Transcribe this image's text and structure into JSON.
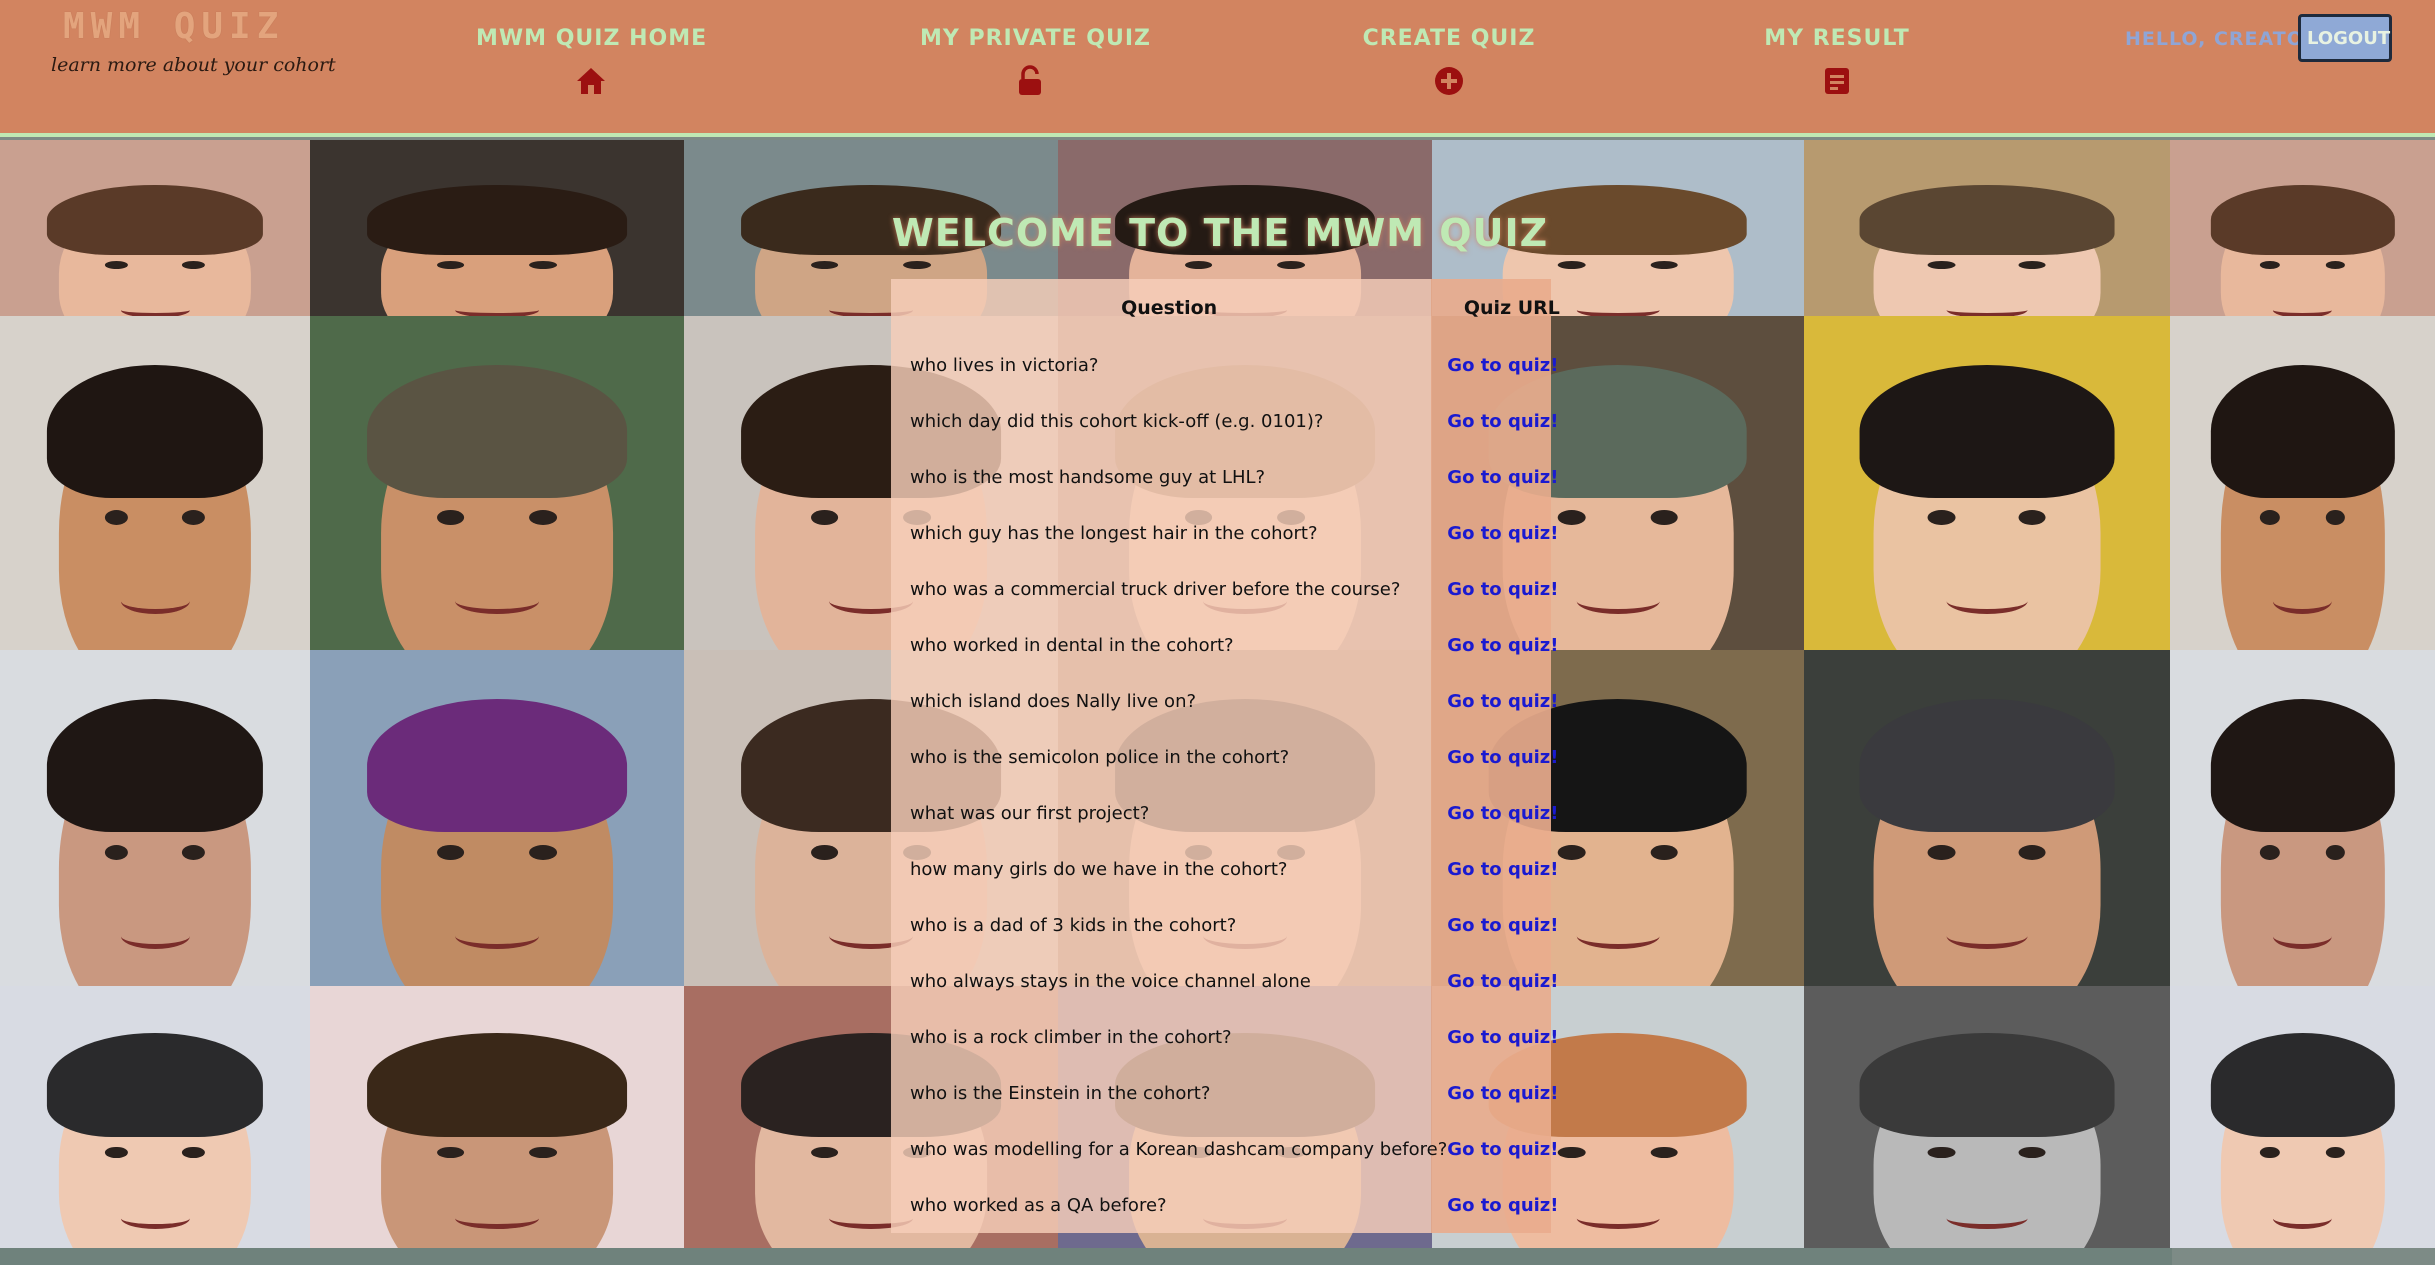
{
  "header": {
    "logo_title": "MWM QUIZ",
    "logo_tagline": "learn more about your cohort",
    "nav": [
      {
        "label": "MWM QUIZ HOME",
        "icon": "home-icon"
      },
      {
        "label": "MY PRIVATE QUIZ",
        "icon": "unlock-icon"
      },
      {
        "label": "CREATE QUIZ",
        "icon": "plus-circle-icon"
      },
      {
        "label": "MY RESULT",
        "icon": "document-icon"
      }
    ],
    "greeting": "HELLO, CREATOR!",
    "logout_label": "LOGOUT"
  },
  "colors": {
    "header_bg": "#d28460",
    "accent_green": "#bfe9b4",
    "icon_red": "#9c1010",
    "link_blue": "#1a1ad0",
    "logout_bg": "#8fa9d6"
  },
  "main": {
    "title": "WELCOME TO THE MWM QUIZ",
    "table": {
      "headers": [
        "Question",
        "Quiz URL"
      ],
      "rows": [
        {
          "question": "who lives in victoria?",
          "link": "Go to quiz!"
        },
        {
          "question": "which day did this cohort kick-off (e.g. 0101)?",
          "link": "Go to quiz!"
        },
        {
          "question": "who is the most handsome guy at LHL?",
          "link": "Go to quiz!"
        },
        {
          "question": "which guy has the longest hair in the cohort?",
          "link": "Go to quiz!"
        },
        {
          "question": "who was a commercial truck driver before the course?",
          "link": "Go to quiz!"
        },
        {
          "question": "who worked in dental in the cohort?",
          "link": "Go to quiz!"
        },
        {
          "question": "which island does Nally live on?",
          "link": "Go to quiz!"
        },
        {
          "question": "who is the semicolon police in the cohort?",
          "link": "Go to quiz!"
        },
        {
          "question": "what was our first project?",
          "link": "Go to quiz!"
        },
        {
          "question": "how many girls do we have in the cohort?",
          "link": "Go to quiz!"
        },
        {
          "question": "who is a dad of 3 kids in the cohort?",
          "link": "Go to quiz!"
        },
        {
          "question": "who always stays in the voice channel alone",
          "link": "Go to quiz!"
        },
        {
          "question": "who is a rock climber in the cohort?",
          "link": "Go to quiz!"
        },
        {
          "question": "who is the Einstein in the cohort?",
          "link": "Go to quiz!"
        },
        {
          "question": "who was modelling for a Korean dashcam company before?",
          "link": "Go to quiz!"
        },
        {
          "question": "who worked as a QA before?",
          "link": "Go to quiz!"
        }
      ]
    }
  }
}
